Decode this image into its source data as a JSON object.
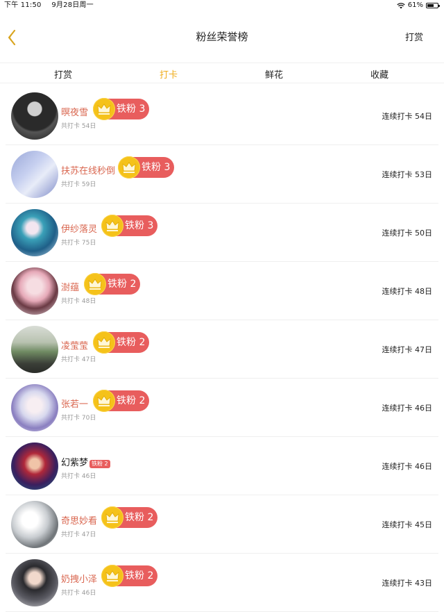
{
  "status_bar": {
    "time": "下午 11:50",
    "date": "9月28日周一",
    "battery": "61%"
  },
  "header": {
    "title": "粉丝荣誉榜",
    "right_action": "打赏"
  },
  "tabs": [
    {
      "label": "打赏",
      "active": false
    },
    {
      "label": "打卡",
      "active": true
    },
    {
      "label": "鲜花",
      "active": false
    },
    {
      "label": "收藏",
      "active": false
    }
  ],
  "fans": [
    {
      "name": "暝夜雪",
      "badge": "铁粉 3",
      "sub": "共打卡 54日",
      "streak": "连续打卡 54日",
      "badge_style": "large"
    },
    {
      "name": "扶苏在线秒倒",
      "badge": "铁粉 3",
      "sub": "共打卡 59日",
      "streak": "连续打卡 53日",
      "badge_style": "large"
    },
    {
      "name": "伊纱落灵",
      "badge": "铁粉 3",
      "sub": "共打卡 75日",
      "streak": "连续打卡 50日",
      "badge_style": "large"
    },
    {
      "name": "澍蕴",
      "badge": "铁粉 2",
      "sub": "共打卡 48日",
      "streak": "连续打卡 48日",
      "badge_style": "large"
    },
    {
      "name": "凌莹莹",
      "badge": "铁粉 2",
      "sub": "共打卡 47日",
      "streak": "连续打卡 47日",
      "badge_style": "large"
    },
    {
      "name": "张若一",
      "badge": "铁粉 2",
      "sub": "共打卡 70日",
      "streak": "连续打卡 46日",
      "badge_style": "large"
    },
    {
      "name": "幻紫梦",
      "badge": "铁粉 2",
      "sub": "共打卡 46日",
      "streak": "连续打卡 46日",
      "badge_style": "small"
    },
    {
      "name": "奇思妙看",
      "badge": "铁粉 2",
      "sub": "共打卡 47日",
      "streak": "连续打卡 45日",
      "badge_style": "large"
    },
    {
      "name": "奶拽小泽",
      "badge": "铁粉 2",
      "sub": "共打卡 46日",
      "streak": "连续打卡 43日",
      "badge_style": "large"
    }
  ],
  "colors": {
    "accent": "#f0ad1c",
    "name": "#d9664f",
    "badge": "#e85d5d",
    "crown": "#f5c21a"
  }
}
